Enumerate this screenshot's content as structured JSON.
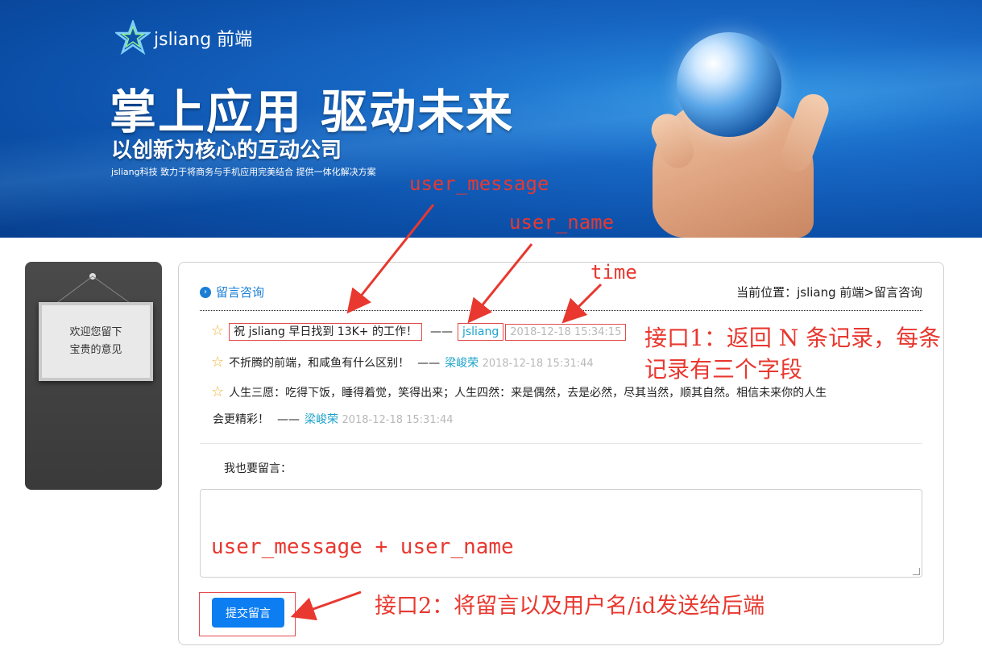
{
  "banner": {
    "brand": "jsliang 前端",
    "slogan_main": "掌上应用 驱动未来",
    "slogan_sub": "以创新为核心的互动公司",
    "slogan_small": "jsliang科技 致力于将商务与手机应用完美结合 提供一体化解决方案"
  },
  "side": {
    "line1": "欢迎您留下",
    "line2": "宝贵的意见"
  },
  "header": {
    "title": "留言咨询",
    "breadcrumb": "当前位置：jsliang 前端>留言咨询"
  },
  "messages": [
    {
      "text": "祝 jsliang 早日找到 13K+ 的工作！",
      "dash": "——",
      "user": "jsliang",
      "time": "2018-12-18 15:34:15"
    },
    {
      "text": "不折腾的前端，和咸鱼有什么区别！",
      "dash": "——",
      "user": "梁峻荣",
      "time": "2018-12-18 15:31:44"
    },
    {
      "text_line1": "人生三愿：吃得下饭，睡得着觉，笑得出来；人生四然：来是偶然，去是必然，尽其当然，顺其自然。相信未来你的人生",
      "text_line2": "会更精彩！",
      "dash": "——",
      "user": "梁峻荣",
      "time": "2018-12-18 15:31:44"
    }
  ],
  "form": {
    "label": "我也要留言：",
    "submit": "提交留言"
  },
  "annotations": {
    "user_message": "user_message",
    "user_name": "user_name",
    "time": "time",
    "api1_line1": "接口1：返回 N 条记录，每条",
    "api1_line2": "记录有三个字段",
    "textarea_note": "user_message + user_name",
    "api2": "接口2：将留言以及用户名/id发送给后端"
  },
  "colors": {
    "annotation": "#e8382f",
    "accent": "#1a7fd4",
    "user": "#1ca3c9",
    "button": "#0d7ef2"
  }
}
